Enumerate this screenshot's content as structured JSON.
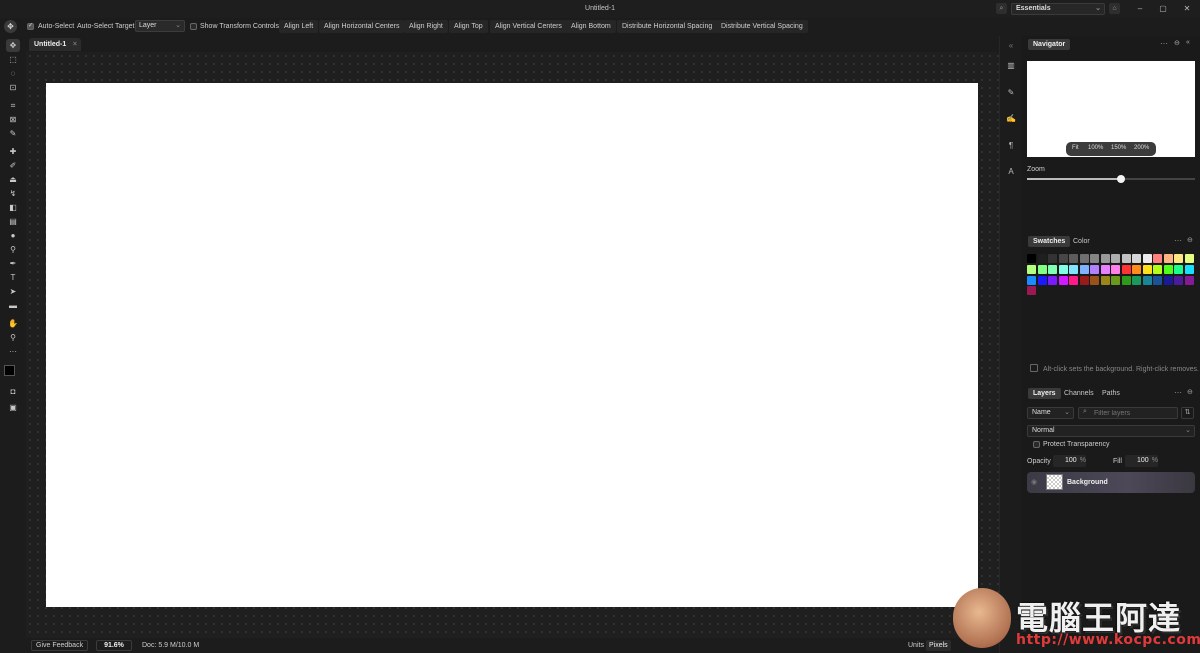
{
  "window": {
    "title": "Untitled-1",
    "workspace": "Essentials",
    "controls": [
      "–",
      "▢",
      "✕"
    ]
  },
  "options_bar": {
    "auto_select": "Auto-Select",
    "auto_select_target": "Auto-Select Target",
    "target_value": "Layer",
    "show_transform": "Show Transform Controls",
    "align_buttons": [
      "Align Left",
      "Align Horizontal Centers",
      "Align Right",
      "Align Top",
      "Align Vertical Centers",
      "Align Bottom",
      "Distribute Horizontal Spacing",
      "Distribute Vertical Spacing"
    ]
  },
  "document": {
    "tab_name": "Untitled-1",
    "canvas_color": "#ffffff"
  },
  "status": {
    "feedback": "Give Feedback",
    "zoom": "91.6%",
    "doc_size": "Doc: 5.9 M/10.0 M",
    "units_label": "Units",
    "units_value": "Pixels"
  },
  "tools": [
    "move-icon",
    "marquee-icon",
    "lasso-icon",
    "object-select-icon",
    "crop-icon",
    "frame-icon",
    "eyedropper-icon",
    "healing-icon",
    "brush-icon",
    "stamp-icon",
    "history-brush-icon",
    "eraser-icon",
    "gradient-icon",
    "blur-icon",
    "dodge-icon",
    "pen-icon",
    "type-icon",
    "path-select-icon",
    "rectangle-icon",
    "hand-icon",
    "zoom-icon",
    "more-icon",
    "color-swap-icon",
    "quick-mask-icon",
    "screen-mode-icon"
  ],
  "navigator": {
    "tab": "Navigator",
    "zoom_presets": [
      "Fit",
      "100%",
      "150%",
      "200%"
    ],
    "zoom_label": "Zoom",
    "zoom_level": 0.56
  },
  "swatches": {
    "tabs": [
      "Swatches",
      "Color"
    ],
    "hint": "Alt-click sets the background. Right-click removes.",
    "colors": [
      "#000000",
      "#1f1f1f",
      "#333333",
      "#474747",
      "#5c5c5c",
      "#707070",
      "#858585",
      "#999999",
      "#adadad",
      "#c2c2c2",
      "#d6d6d6",
      "#ebebeb",
      "#ff8080",
      "#ffb380",
      "#ffe680",
      "#e6ff80",
      "#b3ff80",
      "#80ff80",
      "#80ffb3",
      "#80ffe6",
      "#80e6ff",
      "#80b3ff",
      "#b380ff",
      "#e680ff",
      "#ff80e6",
      "#ff3333",
      "#ff8c1a",
      "#ffe01a",
      "#b3ff1a",
      "#4dff1a",
      "#1aff8c",
      "#1ae0ff",
      "#1a8cff",
      "#1a1aff",
      "#7a1aff",
      "#d11aff",
      "#ff1a8c",
      "#991a1a",
      "#99521a",
      "#99851a",
      "#6b991a",
      "#2e991a",
      "#1a995c",
      "#1a8599",
      "#1a5299",
      "#1a1a99",
      "#4d1a99",
      "#851a99",
      "#991a52"
    ]
  },
  "layers": {
    "tabs": [
      "Layers",
      "Channels",
      "Paths"
    ],
    "sort": "Name",
    "filter_placeholder": "Filter layers",
    "blend_mode": "Normal",
    "protect_transparency": "Protect Transparency",
    "opacity_label": "Opacity",
    "opacity": "100",
    "fill_label": "Fill",
    "fill": "100",
    "pct": "%",
    "items": [
      {
        "name": "Background"
      }
    ]
  },
  "watermark": {
    "title": "電腦王阿達",
    "url": "http://www.kocpc.com.tw/"
  }
}
